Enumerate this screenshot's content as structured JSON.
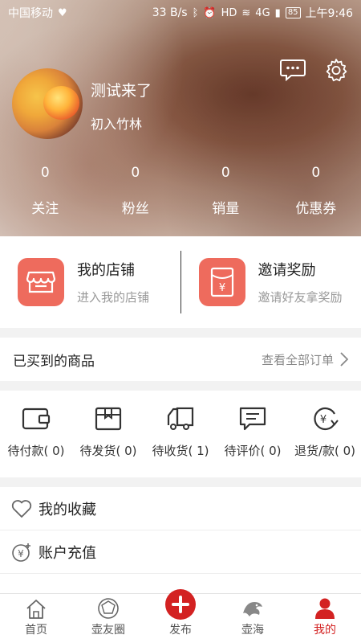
{
  "status_bar": {
    "carrier": "中国移动",
    "speed": "33 B/s",
    "battery": "85",
    "time": "上午9:46",
    "network": "4G"
  },
  "profile": {
    "username": "测试来了",
    "level": "初入竹林",
    "stats": [
      {
        "value": "0",
        "label": "关注"
      },
      {
        "value": "0",
        "label": "粉丝"
      },
      {
        "value": "0",
        "label": "销量"
      },
      {
        "value": "0",
        "label": "优惠券"
      }
    ]
  },
  "cards": {
    "shop": {
      "title": "我的店铺",
      "subtitle": "进入我的店铺"
    },
    "invite": {
      "title": "邀请奖励",
      "subtitle": "邀请好友拿奖励"
    }
  },
  "purchased": {
    "title": "已买到的商品",
    "view_all": "查看全部订单"
  },
  "orders": [
    {
      "label": "待付款( 0)",
      "icon": "wallet-icon"
    },
    {
      "label": "待发货( 0)",
      "icon": "package-icon"
    },
    {
      "label": "待收货( 1)",
      "icon": "truck-icon"
    },
    {
      "label": "待评价( 0)",
      "icon": "comment-icon"
    },
    {
      "label": "退货/款( 0)",
      "icon": "refund-icon"
    }
  ],
  "menu": [
    {
      "label": "我的收藏",
      "icon": "heart-icon"
    },
    {
      "label": "账户充值",
      "icon": "recharge-icon"
    }
  ],
  "tabbar": [
    {
      "label": "首页",
      "icon": "home-icon"
    },
    {
      "label": "壶友圈",
      "icon": "circle-icon"
    },
    {
      "label": "发布",
      "icon": "plus-icon"
    },
    {
      "label": "壶海",
      "icon": "sea-icon"
    },
    {
      "label": "我的",
      "icon": "user-icon",
      "active": true
    }
  ],
  "colors": {
    "accent": "#d32222",
    "card_icon_bg": "#ee6b5d"
  }
}
